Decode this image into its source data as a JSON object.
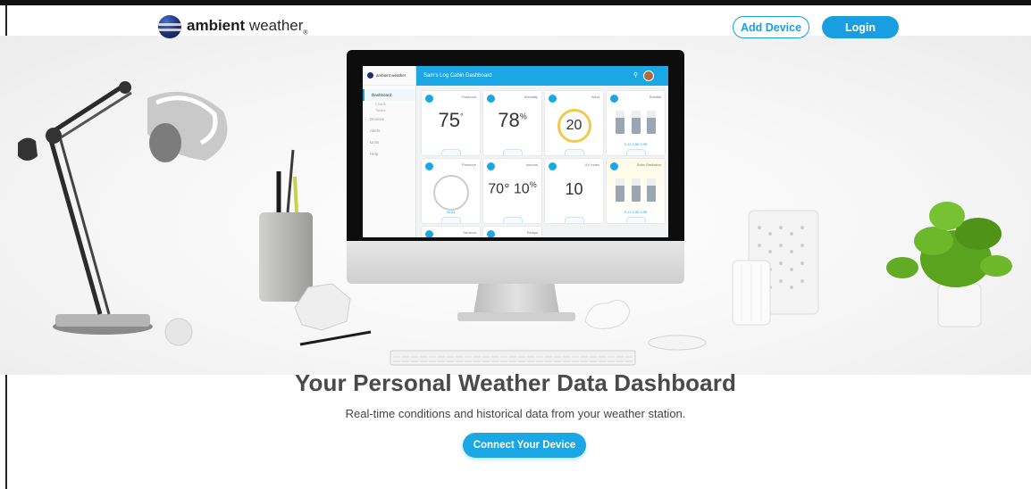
{
  "brand": {
    "name_bold": "ambient",
    "name_light": " weather",
    "mark": "®"
  },
  "header": {
    "add_device_label": "Add Device",
    "login_label": "Login"
  },
  "hero": {
    "title": "Your Personal Weather Data Dashboard",
    "subtitle": "Real-time conditions and historical data from your weather station.",
    "cta_label": "Connect Your Device"
  },
  "screen": {
    "brand": "ambient weather",
    "dashboard_title": "Sam's Log Cabin Dashboard",
    "nav": [
      "Dashboard",
      "Devices",
      "Alerts",
      "Units",
      "Help"
    ],
    "nav_sub": [
      "Charts",
      "Tables"
    ],
    "cards": [
      {
        "name": "Outdoors",
        "value": "75",
        "unit": "°"
      },
      {
        "name": "Humidity",
        "value": "78",
        "unit": "%"
      },
      {
        "name": "Wind",
        "value": "20",
        "unit": ""
      },
      {
        "name": "Rainfall",
        "value": "",
        "unit": ""
      },
      {
        "name": "Pressure",
        "value": "",
        "unit": ""
      },
      {
        "name": "Indoors",
        "value": "70° 10",
        "unit": "%"
      },
      {
        "name": "UV Index",
        "value": "10",
        "unit": ""
      },
      {
        "name": "Solar Radiation",
        "value": "",
        "unit": ""
      }
    ],
    "rain_values": "0.12   0.50   0.95",
    "pressure_value": "30.54",
    "sensors_label": "Sensors",
    "relays_label": "Relays"
  },
  "colors": {
    "accent": "#1a9ee2",
    "screen_bar": "#1aa7e4",
    "navy": "#1d2f73"
  }
}
